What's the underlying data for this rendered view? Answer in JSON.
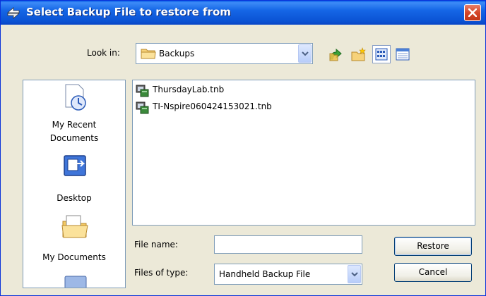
{
  "window": {
    "title": "Select Backup File to restore from",
    "close_label": "close"
  },
  "look_in": {
    "label": "Look in:",
    "value": "Backups"
  },
  "toolbar": {
    "icons": [
      "up-one-level-icon",
      "new-folder-icon",
      "list-view-icon",
      "details-view-icon"
    ]
  },
  "places": [
    {
      "label_line1": "My Recent",
      "label_line2": "Documents",
      "icon": "my-recent-documents-icon"
    },
    {
      "label_line1": "Desktop",
      "label_line2": "",
      "icon": "desktop-icon"
    },
    {
      "label_line1": "My Documents",
      "label_line2": "",
      "icon": "my-documents-icon"
    }
  ],
  "files": [
    {
      "name": "ThursdayLab.tnb",
      "icon": "handheld-backup-file-icon"
    },
    {
      "name": "TI-Nspire060424153021.tnb",
      "icon": "handheld-backup-file-icon"
    }
  ],
  "file_name": {
    "label": "File name:",
    "value": ""
  },
  "file_type": {
    "label": "Files of type:",
    "value": "Handheld Backup File"
  },
  "buttons": {
    "restore": "Restore",
    "cancel": "Cancel"
  },
  "colors": {
    "title_bar": "#0b53d4",
    "dialog_bg": "#ece9d8",
    "close_button": "#d5472a"
  }
}
